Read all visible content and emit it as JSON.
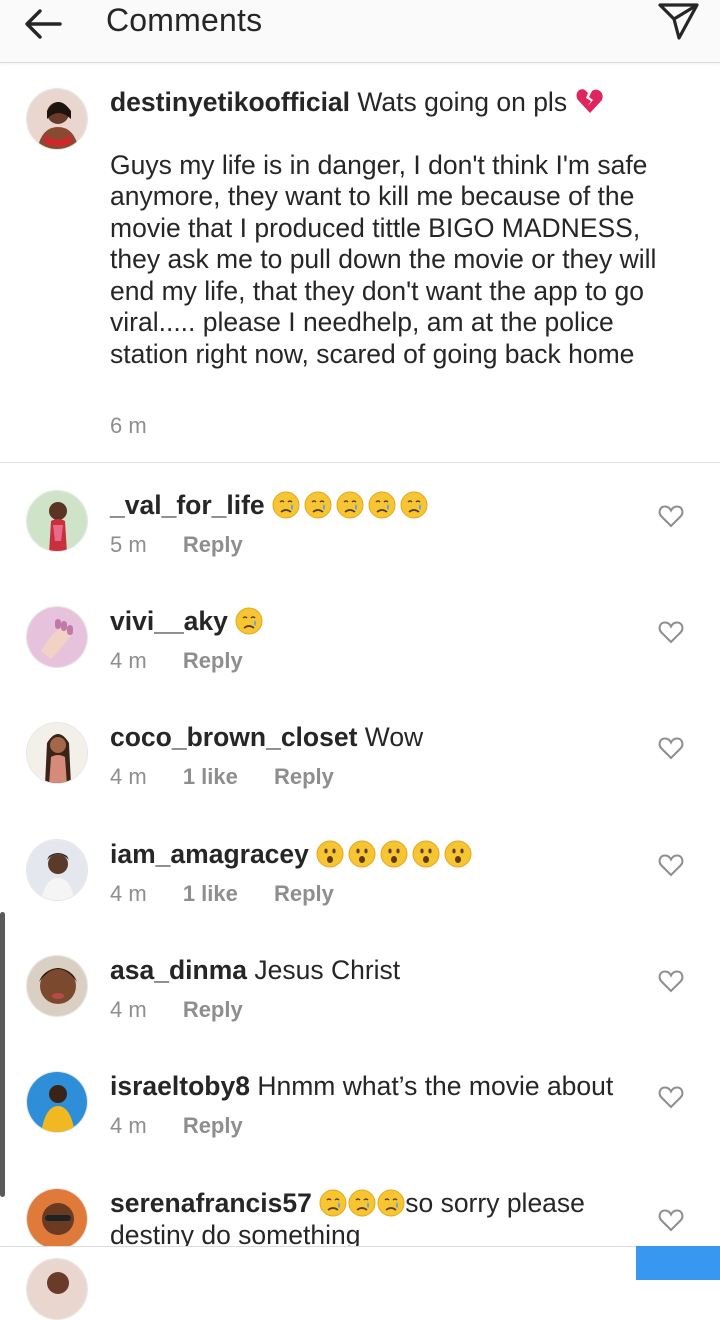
{
  "header": {
    "title": "Comments"
  },
  "caption": {
    "username": "destinyetikoofficial",
    "headline": "Wats going on pls",
    "body": "Guys my life is in danger, I don't think I'm safe anymore, they want to kill me because of the movie that I produced tittle BIGO MADNESS, they ask me to  pull down the movie or they will end my life,  that they don't want the app to go viral..... please I needhelp,  am at the police station right now,  scared of going back home",
    "time": "6 m",
    "icon": "broken-heart"
  },
  "comments": [
    {
      "username": "_val_for_life",
      "text": "",
      "emoji": "crying-face",
      "emoji_count": 5,
      "time": "5 m",
      "likes": "",
      "reply": "Reply"
    },
    {
      "username": "vivi__aky",
      "text": "",
      "emoji": "crying-face",
      "emoji_count": 1,
      "time": "4 m",
      "likes": "",
      "reply": "Reply"
    },
    {
      "username": "coco_brown_closet",
      "text": "Wow",
      "time": "4 m",
      "likes": "1 like",
      "reply": "Reply"
    },
    {
      "username": "iam_amagracey",
      "text": "",
      "emoji": "hushed-face",
      "emoji_count": 5,
      "time": "4 m",
      "likes": "1 like",
      "reply": "Reply"
    },
    {
      "username": "asa_dinma",
      "text": "Jesus Christ",
      "time": "4 m",
      "likes": "",
      "reply": "Reply"
    },
    {
      "username": "israeltoby8",
      "text": "Hnmm what’s the movie about",
      "time": "4 m",
      "likes": "",
      "reply": "Reply"
    },
    {
      "username": "serenafrancis57",
      "text": "so sorry please destiny do something",
      "emoji": "crying-face",
      "emoji_count": 3
    }
  ],
  "colors": {
    "text": "#262626",
    "meta": "#8e8e8e",
    "accent": "#3897f0",
    "emoji_face": "#f7c531"
  }
}
